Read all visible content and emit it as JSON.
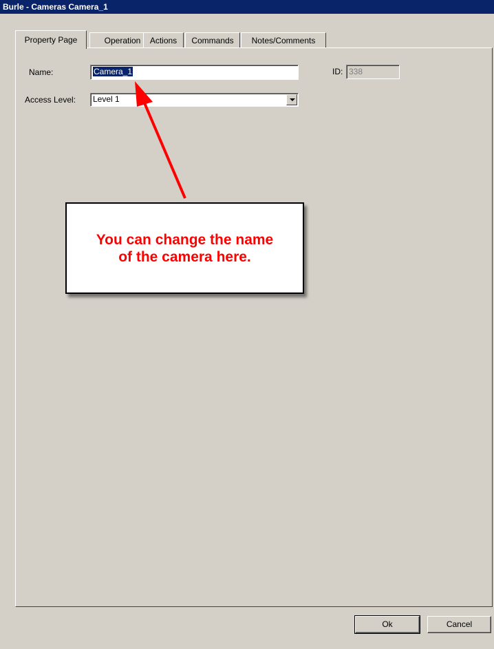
{
  "window": {
    "title": "Burle - Cameras Camera_1"
  },
  "tabs": [
    {
      "label": "Property Page",
      "active": true
    },
    {
      "label": "Operation",
      "active": false
    },
    {
      "label": "Actions",
      "active": false
    },
    {
      "label": "Commands",
      "active": false
    },
    {
      "label": "Notes/Comments",
      "active": false
    }
  ],
  "form": {
    "name_label": "Name:",
    "name_value": "Camera_1",
    "id_label": "ID:",
    "id_value": "338",
    "access_label": "Access Level:",
    "access_value": "Level 1"
  },
  "callout": {
    "text": "You can change the name\nof the camera here."
  },
  "buttons": {
    "ok": "Ok",
    "cancel": "Cancel"
  },
  "colors": {
    "titlebar": "#0a246a",
    "dialog_bg": "#d4d0c8",
    "annotation": "#ff0000"
  }
}
